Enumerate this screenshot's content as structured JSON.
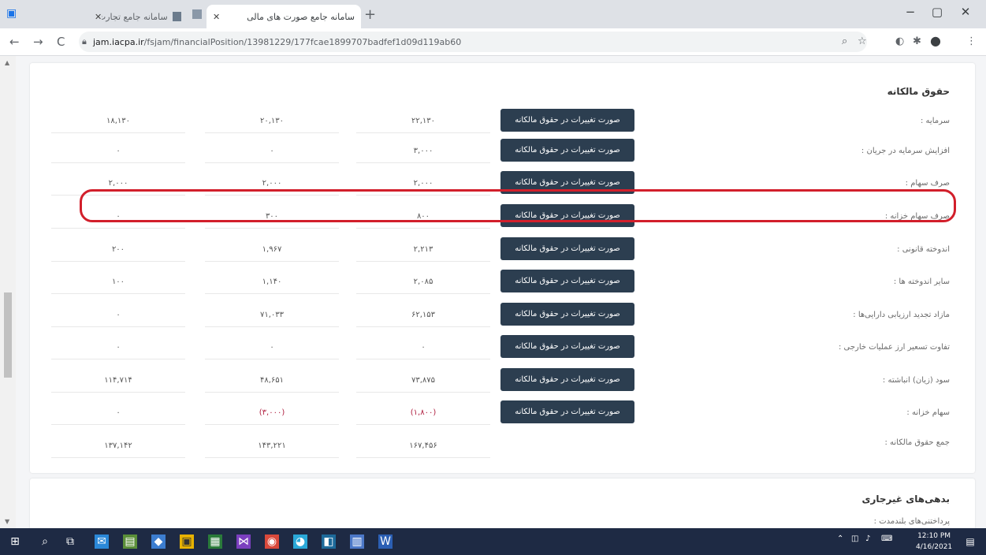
{
  "browser": {
    "tabs": [
      {
        "title": "سامانه جامع تجارت",
        "active": false
      },
      {
        "title": "سامانه جامع صورت های مالی",
        "active": true
      }
    ],
    "new_tab": "+",
    "window_controls": {
      "minimize": "−",
      "maximize": "▢",
      "close": "✕"
    },
    "nav": {
      "back": "←",
      "forward": "→",
      "reload": "C"
    },
    "url_host": "jam.iacpa.ir",
    "url_path": "/fsjam/financialPosition/13981229/177fcae1899707badfef1d09d119ab60"
  },
  "page": {
    "section_title": "حقوق مالکانه",
    "button_label": "صورت تغییرات در حقوق مالکانه",
    "rows": [
      {
        "label": "سرمایه :",
        "v1": "۲۲,۱۳۰",
        "v2": "۲۰,۱۳۰",
        "v3": "۱۸,۱۳۰",
        "button": true
      },
      {
        "label": "افزایش سرمایه در جریان :",
        "v1": "۳,۰۰۰",
        "v2": "۰",
        "v3": "۰",
        "button": true
      },
      {
        "label": "صرف سهام :",
        "v1": "۲,۰۰۰",
        "v2": "۲,۰۰۰",
        "v3": "۲,۰۰۰",
        "button": true
      },
      {
        "label": "صرف سهام خزانه :",
        "v1": "۸۰۰",
        "v2": "۳۰۰",
        "v3": "۰",
        "button": true
      },
      {
        "label": "اندوخته قانونی :",
        "v1": "۲,۲۱۳",
        "v2": "۱,۹۶۷",
        "v3": "۲۰۰",
        "button": true
      },
      {
        "label": "سایر اندوخته ها :",
        "v1": "۲,۰۸۵",
        "v2": "۱,۱۴۰",
        "v3": "۱۰۰",
        "button": true
      },
      {
        "label": "مازاد تجدید ارزیابی دارایی‌ها :",
        "v1": "۶۲,۱۵۳",
        "v2": "۷۱,۰۳۳",
        "v3": "۰",
        "button": true
      },
      {
        "label": "تفاوت تسعیر ارز عملیات خارجی :",
        "v1": "۰",
        "v2": "۰",
        "v3": "۰",
        "button": true
      },
      {
        "label": "سود (زیان) انباشته :",
        "v1": "۷۳,۸۷۵",
        "v2": "۴۸,۶۵۱",
        "v3": "۱۱۴,۷۱۴",
        "button": true
      },
      {
        "label": "سهام خزانه :",
        "v1": "(۱,۸۰۰)",
        "v2": "(۳,۰۰۰)",
        "v3": "۰",
        "button": true,
        "negative": true
      },
      {
        "label": "جمع حقوق مالکانه :",
        "v1": "۱۶۷,۴۵۶",
        "v2": "۱۴۳,۲۲۱",
        "v3": "۱۳۷,۱۴۲",
        "button": false
      }
    ],
    "next_section_title": "بدهی‌های غیرجاری",
    "next_section_first_row": "پرداختنی‌های بلندمدت :"
  },
  "taskbar": {
    "clock_time": "12:10 PM",
    "clock_date": "4/16/2021"
  },
  "colors": {
    "button_bg": "#2c3e50",
    "highlight_border": "#d21f2b",
    "negative_text": "#b02040",
    "taskbar_bg": "#1e2a44"
  }
}
